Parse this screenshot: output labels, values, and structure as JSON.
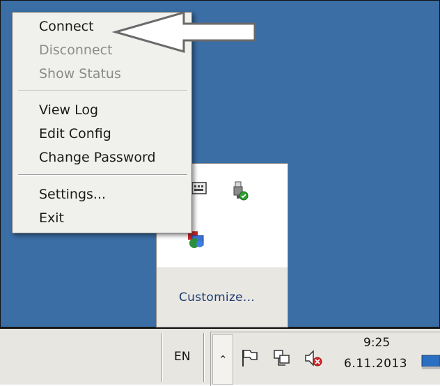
{
  "context_menu": {
    "items": [
      {
        "label": "Connect",
        "enabled": true
      },
      {
        "label": "Disconnect",
        "enabled": false
      },
      {
        "label": "Show Status",
        "enabled": false
      },
      {
        "label": "View Log",
        "enabled": true
      },
      {
        "label": "Edit Config",
        "enabled": true
      },
      {
        "label": "Change Password",
        "enabled": true
      },
      {
        "label": "Settings...",
        "enabled": true
      },
      {
        "label": "Exit",
        "enabled": true
      }
    ]
  },
  "arrow_annotation": {
    "direction": "left",
    "points_to": "Connect"
  },
  "tray_flyout": {
    "icons": [
      "keyboard-icon",
      "usb-safe-remove-icon",
      "network-shield-icon"
    ],
    "customize_label": "Customize..."
  },
  "taskbar": {
    "language": "EN",
    "tray_icons": [
      "action-center-flag-icon",
      "network-icon",
      "speaker-muted-icon"
    ],
    "time": "9:25",
    "date": "6.11.2013"
  },
  "colors": {
    "desktop_bg": "#3a6ea5",
    "menu_bg": "#f0f0ec",
    "taskbar_bg": "#e8e6e0",
    "disabled_text": "#8b8b8b"
  }
}
